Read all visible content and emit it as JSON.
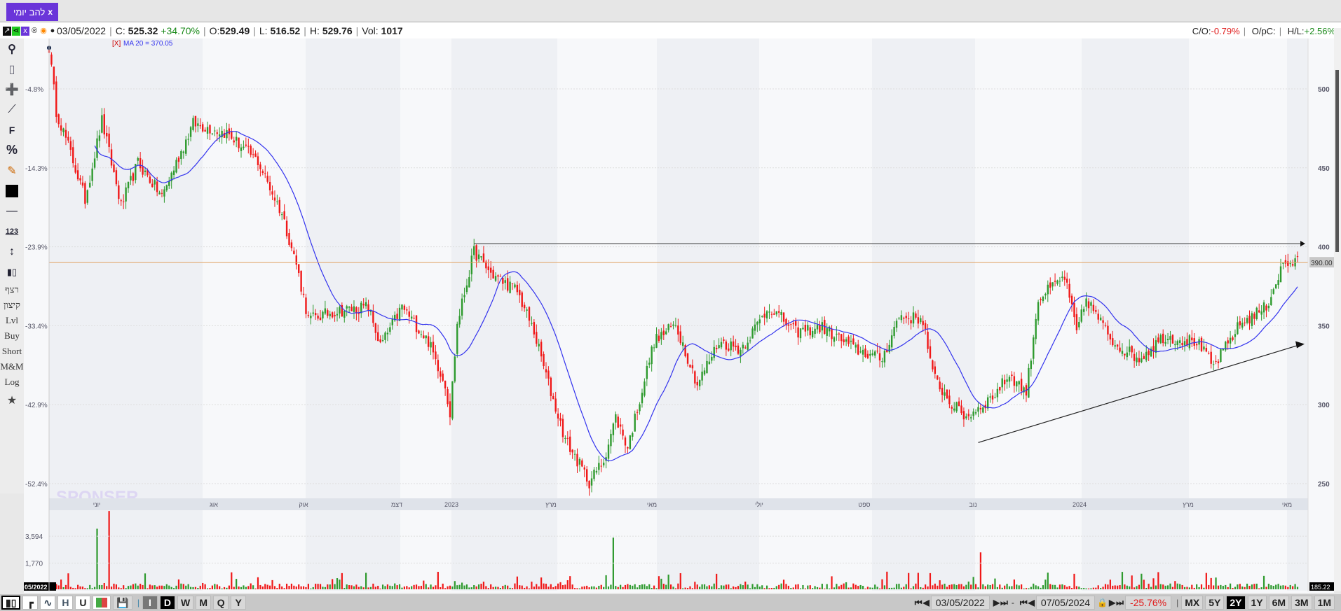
{
  "tab": {
    "label": "להב יומי",
    "close": "x"
  },
  "info": {
    "date": "03/05/2022",
    "c_label": "C:",
    "close": "525.32",
    "change": "+34.70%",
    "o_label": "O:",
    "open": "529.49",
    "l_label": "L:",
    "low": "516.52",
    "h_label": "H:",
    "high": "529.76",
    "vol_label": "Vol:",
    "vol": "1017",
    "icons": [
      "chart-link-icon",
      "share-icon",
      "document-icon",
      "registered-icon",
      "target-icon",
      "comment-icon"
    ]
  },
  "info_right": {
    "co_label": "C/O:",
    "co": "-0.79%",
    "opc_label": "O/pC:",
    "hl_label": "H/L:",
    "hl": "+2.56%"
  },
  "ma_legend": {
    "remove": "[X]",
    "text": "MA 20 = 370.05"
  },
  "left_toolbar": {
    "icons": [
      "search-icon",
      "eraser-icon",
      "crosshair-icon",
      "line-tool-icon",
      "fibonacci-icon",
      "percent-icon",
      "edit-icon",
      "color-swatch-icon",
      "line-width-icon",
      "measure-icon",
      "vertical-range-icon",
      "candles-icon"
    ],
    "text_items": [
      "רצף",
      "קיצון",
      "Lvl",
      "Buy",
      "Short",
      "M&M",
      "Log"
    ]
  },
  "colors": {
    "up": "#2e9a2e",
    "down": "#f01818",
    "ma": "#3333ee",
    "hline": "#e0a060",
    "accent": "#6a35d9"
  },
  "chart_data": {
    "type": "candlestick",
    "price_ticks": [
      500,
      450,
      400,
      350,
      300,
      250
    ],
    "percent_ticks": [
      "-4.8%",
      "-14.3%",
      "-23.9%",
      "-33.4%",
      "-42.9%",
      "-52.4%"
    ],
    "x_labels": [
      "יוני",
      "אוג",
      "אוק",
      "דצמ",
      "2023",
      "מרץ",
      "מאי",
      "יולי",
      "ספט",
      "נוב",
      "2024",
      "מרץ",
      "מאי"
    ],
    "bars": 521,
    "price_anchors": [
      [
        0,
        526
      ],
      [
        3,
        486
      ],
      [
        8,
        464
      ],
      [
        15,
        430
      ],
      [
        22,
        480
      ],
      [
        30,
        426
      ],
      [
        37,
        453
      ],
      [
        47,
        432
      ],
      [
        60,
        478
      ],
      [
        74,
        472
      ],
      [
        87,
        454
      ],
      [
        97,
        421
      ],
      [
        103,
        389
      ],
      [
        108,
        354
      ],
      [
        119,
        359
      ],
      [
        133,
        362
      ],
      [
        138,
        337
      ],
      [
        147,
        362
      ],
      [
        158,
        340
      ],
      [
        165,
        313
      ],
      [
        167,
        294
      ],
      [
        170,
        351
      ],
      [
        177,
        397
      ],
      [
        184,
        383
      ],
      [
        195,
        372
      ],
      [
        202,
        346
      ],
      [
        209,
        308
      ],
      [
        215,
        278
      ],
      [
        225,
        251
      ],
      [
        231,
        265
      ],
      [
        236,
        292
      ],
      [
        241,
        273
      ],
      [
        252,
        340
      ],
      [
        261,
        351
      ],
      [
        270,
        313
      ],
      [
        279,
        340
      ],
      [
        288,
        335
      ],
      [
        300,
        362
      ],
      [
        311,
        346
      ],
      [
        322,
        349
      ],
      [
        336,
        335
      ],
      [
        347,
        329
      ],
      [
        354,
        356
      ],
      [
        364,
        354
      ],
      [
        368,
        319
      ],
      [
        375,
        302
      ],
      [
        382,
        292
      ],
      [
        393,
        305
      ],
      [
        400,
        319
      ],
      [
        407,
        308
      ],
      [
        412,
        367
      ],
      [
        423,
        381
      ],
      [
        428,
        346
      ],
      [
        432,
        367
      ],
      [
        443,
        340
      ],
      [
        454,
        329
      ],
      [
        464,
        343
      ],
      [
        478,
        340
      ],
      [
        485,
        324
      ],
      [
        496,
        351
      ],
      [
        507,
        362
      ],
      [
        514,
        389
      ],
      [
        520,
        390
      ]
    ],
    "ma_period": 20,
    "horizontal_levels": [
      {
        "price": 402,
        "from_bar": 177,
        "color": "#333333"
      },
      {
        "price": 390,
        "from_bar": 0,
        "color": "#e0a060"
      }
    ],
    "trendline": {
      "from": [
        387,
        276
      ],
      "to": [
        521,
        338
      ]
    },
    "last_price_label": "390.00",
    "volume_ticks": [
      "3,594",
      "1,770"
    ],
    "volume_tick_values": [
      3594,
      1770
    ],
    "volume_spikes": [
      [
        20,
        4100,
        "up"
      ],
      [
        25,
        5300,
        "down"
      ],
      [
        235,
        3500,
        "up"
      ],
      [
        388,
        2500,
        "down"
      ]
    ],
    "volume_left_label": "05/2022",
    "volume_right_label": "185.22",
    "watermark": "SPONSER"
  },
  "bottom": {
    "chart_types": [
      "candle-chart-icon",
      "bar-chart-icon",
      "line-chart-icon",
      "H",
      "U",
      "color-bars-icon",
      "save-icon"
    ],
    "periods": [
      "I",
      "D",
      "W",
      "M",
      "Q",
      "Y"
    ],
    "active_period": "D",
    "start_date": "03/05/2022",
    "dash": "-",
    "end_date": "07/05/2024",
    "change": "-25.76%",
    "ranges": [
      "MX",
      "5Y",
      "2Y",
      "1Y",
      "6M",
      "3M",
      "1M"
    ],
    "active_range": "2Y"
  }
}
